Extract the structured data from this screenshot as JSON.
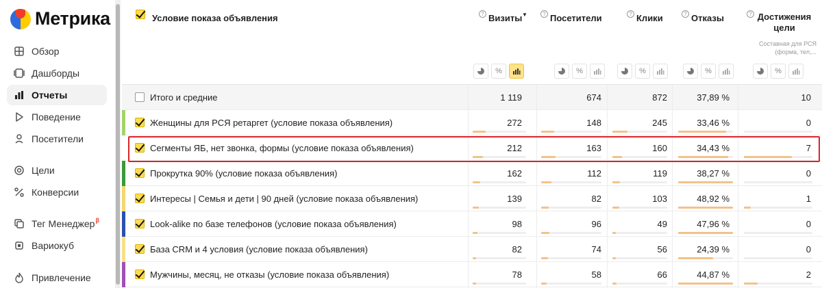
{
  "app": {
    "title": "Метрика"
  },
  "sidebar": {
    "items": [
      {
        "label": "Обзор",
        "icon": "grid-icon",
        "active": false
      },
      {
        "label": "Дашборды",
        "icon": "dashboard-icon",
        "active": false
      },
      {
        "label": "Отчеты",
        "icon": "reports-icon",
        "active": true
      },
      {
        "label": "Поведение",
        "icon": "play-icon",
        "active": false
      },
      {
        "label": "Посетители",
        "icon": "person-icon",
        "active": false
      },
      {
        "label": "Цели",
        "icon": "target-icon",
        "active": false
      },
      {
        "label": "Конверсии",
        "icon": "percent-icon",
        "active": false
      },
      {
        "label": "Тег Менеджер",
        "icon": "tag-icon",
        "active": false,
        "badge": "β"
      },
      {
        "label": "Вариокуб",
        "icon": "cube-icon",
        "active": false
      },
      {
        "label": "Привлечение",
        "icon": "fire-icon",
        "active": false
      }
    ]
  },
  "table": {
    "dimension_header": "Условие показа объявления",
    "metrics": [
      {
        "name": "Визиты",
        "sorted": true
      },
      {
        "name": "Посетители"
      },
      {
        "name": "Клики"
      },
      {
        "name": "Отказы"
      },
      {
        "name": "Достижения цели",
        "sub": "Составная для РСЯ (форма, тел,..."
      }
    ],
    "total": {
      "label": "Итого и средние",
      "values": [
        "1 119",
        "674",
        "872",
        "37,89 %",
        "10"
      ]
    },
    "rows": [
      {
        "label": "Женщины для РСЯ ретаргет (условие показа объявления)",
        "color": "#a4d36b",
        "values": [
          "272",
          "148",
          "245",
          "33,46 %",
          "0"
        ],
        "bars": [
          0.24,
          0.22,
          0.28,
          0.88,
          0.0
        ]
      },
      {
        "label": "Сегменты ЯБ, нет звонка, формы (условие показа объявления)",
        "color": "#ffffff",
        "values": [
          "212",
          "163",
          "160",
          "34,43 %",
          "7"
        ],
        "bars": [
          0.19,
          0.24,
          0.18,
          0.91,
          0.7
        ]
      },
      {
        "label": "Прокрутка 90% (условие показа объявления)",
        "color": "#3a9a3a",
        "values": [
          "162",
          "112",
          "119",
          "38,27 %",
          "0"
        ],
        "bars": [
          0.14,
          0.17,
          0.14,
          1.0,
          0.0
        ]
      },
      {
        "label": "Интересы | Семья и дети | 90 дней (условие показа объявления)",
        "color": "#f5d76e",
        "values": [
          "139",
          "82",
          "103",
          "48,92 %",
          "1"
        ],
        "bars": [
          0.12,
          0.12,
          0.12,
          1.0,
          0.1
        ]
      },
      {
        "label": "Look-alike по базе телефонов (условие показа объявления)",
        "color": "#2a4fb4",
        "values": [
          "98",
          "96",
          "49",
          "47,96 %",
          "0"
        ],
        "bars": [
          0.09,
          0.14,
          0.06,
          1.0,
          0.0
        ]
      },
      {
        "label": "База CRM и 4 условия (условие показа объявления)",
        "color": "#f7e08a",
        "values": [
          "82",
          "74",
          "56",
          "24,39 %",
          "0"
        ],
        "bars": [
          0.07,
          0.11,
          0.06,
          0.64,
          0.0
        ]
      },
      {
        "label": "Мужчины, месяц, не отказы (условие показа объявления)",
        "color": "#a04fb8",
        "values": [
          "78",
          "58",
          "66",
          "44,87 %",
          "2"
        ],
        "bars": [
          0.07,
          0.09,
          0.08,
          1.0,
          0.2
        ]
      }
    ]
  }
}
